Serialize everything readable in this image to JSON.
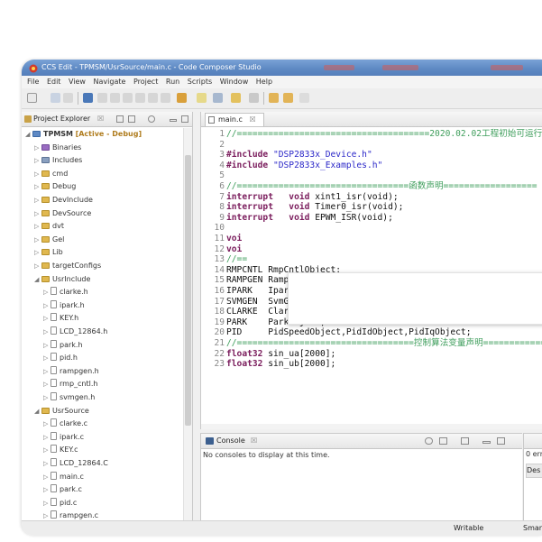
{
  "window": {
    "title": "CCS Edit - TPMSM/UsrSource/main.c - Code Composer Studio"
  },
  "menu": [
    "File",
    "Edit",
    "View",
    "Navigate",
    "Project",
    "Run",
    "Scripts",
    "Window",
    "Help"
  ],
  "explorer": {
    "tab_label": "Project Explorer",
    "tab_close": "☒",
    "project": {
      "name": "TPMSM",
      "decoration": "[Active - Debug]"
    },
    "items": [
      {
        "label": "Binaries",
        "icon": "binaries-icon"
      },
      {
        "label": "Includes",
        "icon": "includes-icon"
      },
      {
        "label": "cmd",
        "icon": "folder-icon"
      },
      {
        "label": "Debug",
        "icon": "folder-icon"
      },
      {
        "label": "DevInclude",
        "icon": "folder-icon"
      },
      {
        "label": "DevSource",
        "icon": "folder-icon"
      },
      {
        "label": "dvt",
        "icon": "folder-icon"
      },
      {
        "label": "Gel",
        "icon": "folder-icon"
      },
      {
        "label": "Lib",
        "icon": "folder-icon"
      },
      {
        "label": "targetConfigs",
        "icon": "folder-icon"
      },
      {
        "label": "UsrInclude",
        "icon": "folder-icon"
      },
      {
        "label": "clarke.h",
        "icon": "file-icon"
      },
      {
        "label": "ipark.h",
        "icon": "file-icon"
      },
      {
        "label": "KEY.h",
        "icon": "file-icon"
      },
      {
        "label": "LCD_12864.h",
        "icon": "file-icon"
      },
      {
        "label": "park.h",
        "icon": "file-icon"
      },
      {
        "label": "pid.h",
        "icon": "file-icon"
      },
      {
        "label": "rampgen.h",
        "icon": "file-icon"
      },
      {
        "label": "rmp_cntl.h",
        "icon": "file-icon"
      },
      {
        "label": "svmgen.h",
        "icon": "file-icon"
      },
      {
        "label": "UsrSource",
        "icon": "folder-icon"
      },
      {
        "label": "clarke.c",
        "icon": "file-icon"
      },
      {
        "label": "ipark.c",
        "icon": "file-icon"
      },
      {
        "label": "KEY.c",
        "icon": "file-icon"
      },
      {
        "label": "LCD_12864.C",
        "icon": "file-icon"
      },
      {
        "label": "main.c",
        "icon": "file-icon"
      },
      {
        "label": "park.c",
        "icon": "file-icon"
      },
      {
        "label": "pid.c",
        "icon": "file-icon"
      },
      {
        "label": "rampgen.c",
        "icon": "file-icon"
      }
    ]
  },
  "editor": {
    "tab_label": "main.c",
    "tab_close": "☒",
    "lines": [
      {
        "n": "1",
        "parts": [
          {
            "c": "c-comment",
            "t": "//=====================================2020.02.02工程初始可运行上"
          }
        ]
      },
      {
        "n": "2",
        "parts": []
      },
      {
        "n": "3",
        "parts": [
          {
            "c": "c-pre",
            "t": "#include "
          },
          {
            "c": "c-str",
            "t": "\"DSP2833x_Device.h\""
          }
        ]
      },
      {
        "n": "4",
        "parts": [
          {
            "c": "c-pre",
            "t": "#include "
          },
          {
            "c": "c-str",
            "t": "\"DSP2833x_Examples.h\""
          }
        ]
      },
      {
        "n": "5",
        "parts": []
      },
      {
        "n": "6",
        "parts": [
          {
            "c": "c-comment",
            "t": "//=================================函数声明=================="
          }
        ]
      },
      {
        "n": "7",
        "parts": [
          {
            "c": "c-kw",
            "t": "interrupt   void "
          },
          {
            "c": "c-plain",
            "t": "xint1_isr(void);"
          }
        ]
      },
      {
        "n": "8",
        "parts": [
          {
            "c": "c-kw",
            "t": "interrupt   void "
          },
          {
            "c": "c-plain",
            "t": "Timer0_isr(void);"
          }
        ]
      },
      {
        "n": "9",
        "parts": [
          {
            "c": "c-kw",
            "t": "interrupt   void "
          },
          {
            "c": "c-plain",
            "t": "EPWM_ISR(void);"
          }
        ]
      },
      {
        "n": "10",
        "parts": []
      },
      {
        "n": "11",
        "parts": [
          {
            "c": "c-kw",
            "t": "voi"
          }
        ]
      },
      {
        "n": "12",
        "parts": [
          {
            "c": "c-kw",
            "t": "voi"
          }
        ]
      },
      {
        "n": "13",
        "parts": [
          {
            "c": "c-comment",
            "t": "//=="
          }
        ]
      },
      {
        "n": "14",
        "parts": [
          {
            "c": "c-plain",
            "t": "RMPCNTL RmpCntlObject;"
          }
        ]
      },
      {
        "n": "15",
        "parts": [
          {
            "c": "c-plain",
            "t": "RAMPGEN RampGenObject;"
          }
        ]
      },
      {
        "n": "16",
        "parts": [
          {
            "c": "c-plain",
            "t": "IPARK   IparkObject;"
          }
        ]
      },
      {
        "n": "17",
        "parts": [
          {
            "c": "c-plain",
            "t": "SVMGEN  SvmGenObject;"
          }
        ]
      },
      {
        "n": "18",
        "parts": [
          {
            "c": "c-plain",
            "t": "CLARKE  ClarkeObject;"
          }
        ]
      },
      {
        "n": "19",
        "parts": [
          {
            "c": "c-plain",
            "t": "PARK    ParkObject;"
          }
        ]
      },
      {
        "n": "20",
        "parts": [
          {
            "c": "c-plain",
            "t": "PID     PidSpeedObject,PidIdObject,PidIqObject;"
          }
        ]
      },
      {
        "n": "21",
        "parts": [
          {
            "c": "c-comment",
            "t": "//==================================控制算法变量声明============="
          }
        ]
      },
      {
        "n": "22",
        "parts": [
          {
            "c": "c-kw",
            "t": "float32 "
          },
          {
            "c": "c-plain",
            "t": "sin_ua[2000];"
          }
        ]
      },
      {
        "n": "23",
        "parts": [
          {
            "c": "c-kw",
            "t": "float32 "
          },
          {
            "c": "c-plain",
            "t": "sin_ub[2000];"
          }
        ]
      }
    ]
  },
  "console": {
    "tab_label": "Console",
    "tab_close": "☒",
    "message": "No consoles to display at this time."
  },
  "problems": {
    "line1": "0 err",
    "line2": "Des"
  },
  "status": {
    "writable": "Writable",
    "insert_mode": "Smar"
  },
  "colors": {
    "titlebar": "#5f8ac4",
    "folder": "#e0b84f",
    "comment": "#3f9e5c",
    "keyword": "#7a1c5c",
    "string": "#2a26c8"
  }
}
